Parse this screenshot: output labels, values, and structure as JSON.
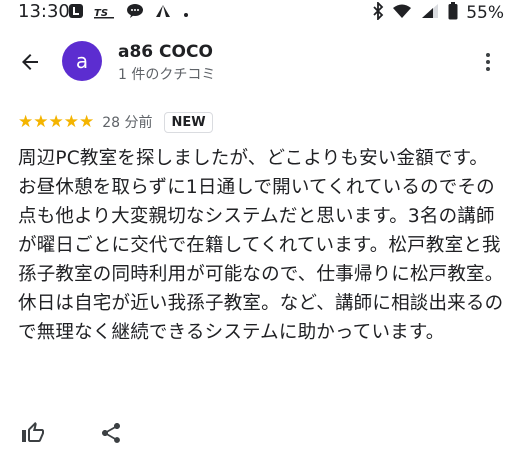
{
  "status_bar": {
    "time": "13:30",
    "battery": "55%",
    "icons_left": [
      "notification-icon",
      "app-icon",
      "line-icon",
      "maps-icon",
      "dot-icon"
    ],
    "icons_right": [
      "bluetooth-icon",
      "wifi-icon",
      "signal-icon",
      "battery-icon"
    ]
  },
  "header": {
    "avatar_letter": "a",
    "reviewer_name": "a86 COCO",
    "review_count": "1 件のクチコミ"
  },
  "review": {
    "stars": "★★★★★",
    "time_ago": "28 分前",
    "badge": "NEW",
    "text": "周辺PC教室を探しましたが、どこよりも安い金額です。お昼休憩を取らずに1日通しで開いてくれているのでその点も他より大変親切なシステムだと思います。3名の講師が曜日ごとに交代で在籍してくれています。松戸教室と我孫子教室の同時利用が可能なので、仕事帰りに松戸教室。休日は自宅が近い我孫子教室。など、講師に相談出来るので無理なく継続できるシステムに助かっています。"
  },
  "colors": {
    "avatar_bg": "#5c2dd0",
    "star": "#f4b400"
  }
}
